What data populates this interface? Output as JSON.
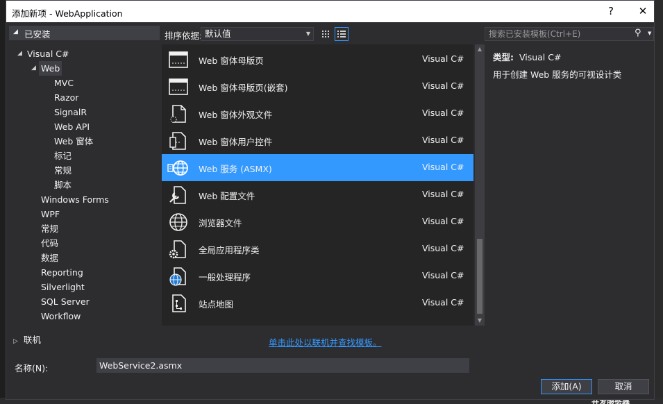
{
  "window": {
    "title": "添加新项 - WebApplication",
    "help_label": "?",
    "close_label": "✕"
  },
  "tree": {
    "installed_label": "已安装",
    "items": [
      {
        "label": "Visual C#",
        "level": 1,
        "caret": "◢"
      },
      {
        "label": "Web",
        "level": 2,
        "caret": "◢",
        "selected": true
      },
      {
        "label": "MVC",
        "level": 3
      },
      {
        "label": "Razor",
        "level": 3
      },
      {
        "label": "SignalR",
        "level": 3
      },
      {
        "label": "Web API",
        "level": 3
      },
      {
        "label": "Web 窗体",
        "level": 3
      },
      {
        "label": "标记",
        "level": 3
      },
      {
        "label": "常规",
        "level": 3
      },
      {
        "label": "脚本",
        "level": 3
      },
      {
        "label": "Windows Forms",
        "level": 2
      },
      {
        "label": "WPF",
        "level": 2
      },
      {
        "label": "常规",
        "level": 2
      },
      {
        "label": "代码",
        "level": 2
      },
      {
        "label": "数据",
        "level": 2
      },
      {
        "label": "Reporting",
        "level": 2
      },
      {
        "label": "Silverlight",
        "level": 2
      },
      {
        "label": "SQL Server",
        "level": 2
      },
      {
        "label": "Workflow",
        "level": 2
      }
    ],
    "online_label": "联机"
  },
  "toolbar": {
    "sort_label": "排序依据:",
    "sort_value": "默认值",
    "search_placeholder": "搜索已安装模板(Ctrl+E)"
  },
  "templates": [
    {
      "name": "Web 窗体母版页",
      "lang": "Visual C#",
      "icon": "master-page-icon"
    },
    {
      "name": "Web 窗体母版页(嵌套)",
      "lang": "Visual C#",
      "icon": "nested-master-page-icon"
    },
    {
      "name": "Web 窗体外观文件",
      "lang": "Visual C#",
      "icon": "skin-file-icon"
    },
    {
      "name": "Web 窗体用户控件",
      "lang": "Visual C#",
      "icon": "user-control-icon"
    },
    {
      "name": "Web 服务 (ASMX)",
      "lang": "Visual C#",
      "icon": "web-service-icon",
      "selected": true
    },
    {
      "name": "Web 配置文件",
      "lang": "Visual C#",
      "icon": "config-file-icon"
    },
    {
      "name": "浏览器文件",
      "lang": "Visual C#",
      "icon": "browser-file-icon"
    },
    {
      "name": "全局应用程序类",
      "lang": "Visual C#",
      "icon": "global-class-icon"
    },
    {
      "name": "一般处理程序",
      "lang": "Visual C#",
      "icon": "generic-handler-icon"
    },
    {
      "name": "站点地图",
      "lang": "Visual C#",
      "icon": "sitemap-icon"
    }
  ],
  "online_link": "单击此处以联机并查找模板。",
  "detail": {
    "type_label": "类型:",
    "type_value": "Visual C#",
    "description": "用于创建 Web 服务的可视设计类"
  },
  "bottom": {
    "name_label": "名称(N):",
    "name_value": "WebService2.asmx",
    "add_label": "添加(A)",
    "cancel_label": "取消"
  },
  "background": {
    "status_text": "开发服务器"
  },
  "colors": {
    "accent": "#3399ff",
    "dialog_bg": "#2d2d30",
    "list_bg": "#252526"
  }
}
